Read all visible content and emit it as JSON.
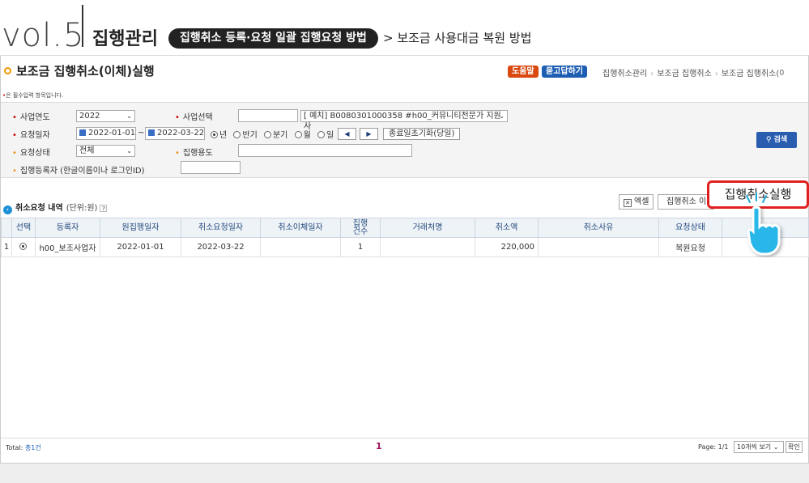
{
  "banner": {
    "vol": "vol.5",
    "section": "집행관리",
    "pill": "집행취소 등록·요청 일괄 집행요청 방법",
    "subhead": "> 보조금 사용대금 복원 방법"
  },
  "page": {
    "title": "보조금 집행취소(이체)실행",
    "help_label": "도움말",
    "faq_label": "묻고답하기",
    "breadcrumb": [
      "집행취소관리",
      "보조금 집행취소",
      "보조금 집행취소(이"
    ],
    "required_note": "은 필수입력 항목입니다."
  },
  "search": {
    "year_label": "사업연도",
    "year_value": "2022",
    "business_label": "사업선택",
    "business_value": "",
    "business_select": "[  예치] B0080301000358 #h00_커뮤니티전문가 지원사",
    "request_date_label": "요청일자",
    "date_from": "2022-01-01",
    "date_tilde": "~",
    "date_to": "2022-03-22",
    "period_options": [
      "년",
      "반기",
      "분기",
      "월",
      "일"
    ],
    "period_selected": "년",
    "prev_label": "◀",
    "next_label": "▶",
    "reset_label": "종료일초기화(당일)",
    "status_label": "요청상태",
    "status_value": "전체",
    "usage_label": "집행용도",
    "usage_value": "",
    "registrant_label": "집행등록자 (한글이름이나 로그인ID)",
    "registrant_value": "",
    "search_button": "검색"
  },
  "list": {
    "title": "취소요청 내역",
    "unit": "(단위:원)",
    "help_mark": "?",
    "excel_label": "엑셀",
    "exec_small_label": "집행취소 이",
    "exec_callout": "집행취소실행",
    "columns": [
      "",
      "선택",
      "등록자",
      "원집행일자",
      "취소요청일자",
      "취소이체일자",
      "집행\n건수",
      "거래처명",
      "취소액",
      "취소사유",
      "요청상태",
      ""
    ],
    "rows": [
      {
        "no": "1",
        "registrant": "h00_보조사업자",
        "orig_date": "2022-01-01",
        "cancel_req_date": "2022-03-22",
        "cancel_transfer_date": "",
        "count": "1",
        "vendor": "",
        "amount": "220,000",
        "reason": "",
        "status": "복원요청"
      }
    ]
  },
  "footer": {
    "total_prefix": "Total:",
    "total_count": "총1건",
    "page_current": "1",
    "page_info": "Page: 1/1",
    "page_size": "10개씩 보기",
    "confirm_label": "확인"
  },
  "colors": {
    "accent_red": "#e02020",
    "help_orange": "#d9480f",
    "faq_blue": "#1d5eb3",
    "search_blue": "#2a5db0"
  }
}
